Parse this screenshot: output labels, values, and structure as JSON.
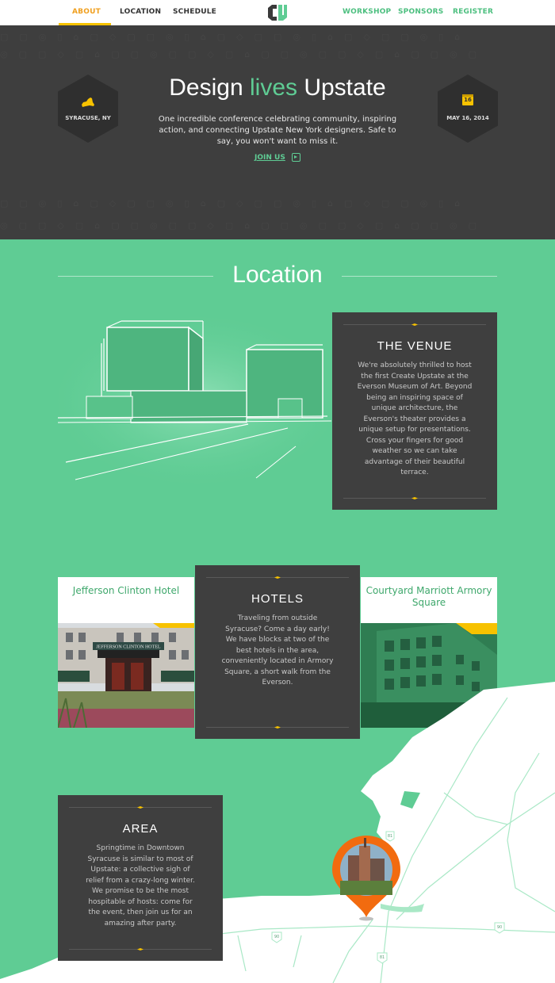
{
  "nav": {
    "left": [
      "ABOUT",
      "LOCATION",
      "SCHEDULE"
    ],
    "right": [
      "WORKSHOP",
      "SPONSORS",
      "REGISTER"
    ],
    "active": "ABOUT"
  },
  "hero": {
    "title_pre": "Design ",
    "title_accent": "lives",
    "title_post": " Upstate",
    "subtitle": "One incredible conference celebrating community, inspiring action, and connecting Upstate New York designers. Safe to say, you won't want to miss it.",
    "cta": "JOIN US",
    "location_badge": "SYRACUSE, NY",
    "date_badge": "MAY 16, 2014",
    "calendar_day": "16"
  },
  "location": {
    "title": "Location",
    "venue": {
      "title": "THE VENUE",
      "body": "We're absolutely thrilled to host the first Create Upstate at the Everson Museum of Art. Beyond being an inspiring space of unique architecture, the Everson's theater provides a unique setup for presentations. Cross your fingers for good weather so we can take advantage of their beautiful terrace."
    },
    "hotels": {
      "title": "HOTELS",
      "body": "Traveling from outside Syracuse? Come a day early! We have blocks at two of the best hotels in the area, conveniently located in Armory Square, a short walk from the Everson.",
      "left_name": "Jefferson Clinton Hotel",
      "left_sign": "JEFFERSON CLINTON HOTEL",
      "right_name": "Courtyard Marriott Armory Square"
    },
    "area": {
      "title": "AREA",
      "body": "Springtime in Downtown Syracuse is similar to most of Upstate: a collective sigh of relief from a crazy-long winter. We promise to be the most hospitable of hosts: come for the event, then join us for an amazing after party."
    },
    "map_shields": [
      "81",
      "90",
      "81",
      "90"
    ]
  },
  "colors": {
    "green": "#5fcc94",
    "dark": "#3f3f3f",
    "accent": "#f7c200",
    "pin": "#f26b0f"
  }
}
